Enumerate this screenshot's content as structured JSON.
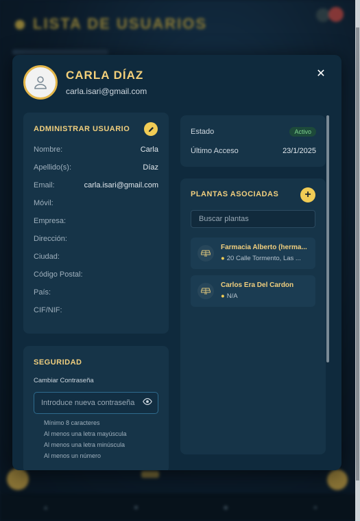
{
  "background": {
    "title": "LISTA DE USUARIOS"
  },
  "user": {
    "name": "CARLA DÍAZ",
    "email": "carla.isari@gmail.com"
  },
  "admin": {
    "title": "ADMINISTRAR USUARIO",
    "fields": [
      {
        "label": "Nombre:",
        "value": "Carla"
      },
      {
        "label": "Apellido(s):",
        "value": "Díaz"
      },
      {
        "label": "Email:",
        "value": "carla.isari@gmail.com"
      },
      {
        "label": "Móvil:",
        "value": ""
      },
      {
        "label": "Empresa:",
        "value": ""
      },
      {
        "label": "Dirección:",
        "value": ""
      },
      {
        "label": "Ciudad:",
        "value": ""
      },
      {
        "label": "Código Postal:",
        "value": ""
      },
      {
        "label": "País:",
        "value": ""
      },
      {
        "label": "CIF/NIF:",
        "value": ""
      }
    ]
  },
  "security": {
    "title": "SEGURIDAD",
    "change_label": "Cambiar Contraseña",
    "password_placeholder": "Introduce nueva contraseña",
    "requirements": [
      "Mínimo 8 caracteres",
      "Al menos una letra mayúscula",
      "Al menos una letra minúscula",
      "Al menos un número"
    ]
  },
  "status": {
    "estado_label": "Estado",
    "estado_value": "Activo",
    "acceso_label": "Último Acceso",
    "acceso_value": "23/1/2025"
  },
  "plants": {
    "title": "PLANTAS ASOCIADAS",
    "search_placeholder": "Buscar plantas",
    "items": [
      {
        "name": "Farmacia Alberto (herma...",
        "address": "20 Calle Tormento, Las ..."
      },
      {
        "name": "Carlos Era Del Cardon",
        "address": "N/A"
      }
    ]
  },
  "colors": {
    "accent": "#f1cc55",
    "title_gold": "#f1cf7e",
    "modal_bg": "#0f2a3d",
    "card_bg": "#163448",
    "active_green": "#7fd38f"
  }
}
